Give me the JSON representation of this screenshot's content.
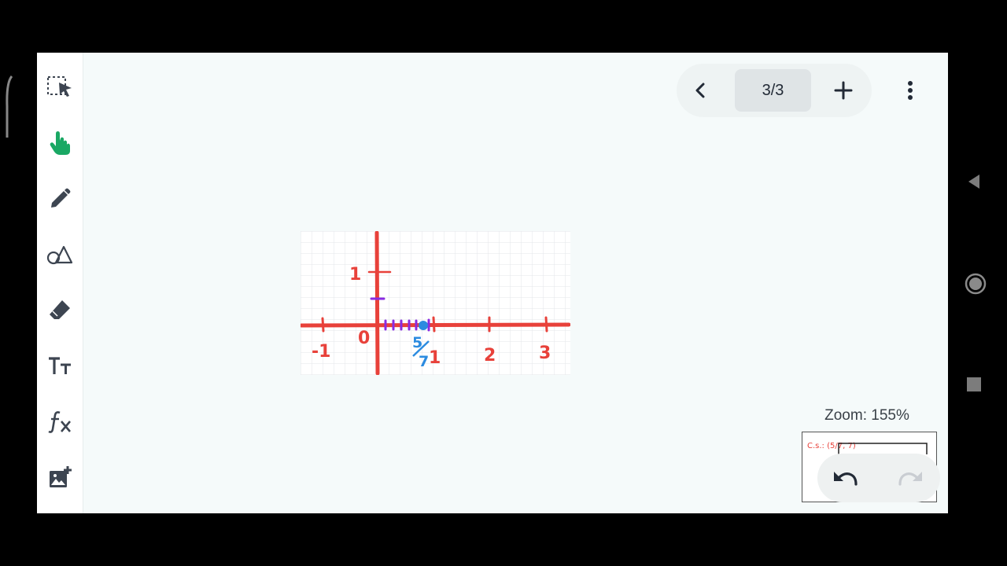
{
  "toolbar": {
    "tools": [
      "select",
      "pan",
      "pen",
      "shapes",
      "eraser",
      "text",
      "function",
      "image"
    ],
    "active_tool": "pan",
    "active_color": "#1aa864",
    "icon_color": "#3d4551"
  },
  "page_nav": {
    "indicator": "3/3",
    "icons": [
      "chevron-left-icon",
      "plus-icon"
    ]
  },
  "zoom": {
    "label": "Zoom: 155%"
  },
  "drawing": {
    "axis_color": "#e8413a",
    "mark_color": "#8a2be2",
    "point_color": "#2b8be0",
    "x_labels": [
      "-1",
      "0",
      "1",
      "2",
      "3"
    ],
    "y_labels": [
      "1"
    ],
    "fraction": {
      "numerator": "5",
      "denominator": "7"
    }
  },
  "minimap": {
    "text": "C.s.: (5/7, 7)"
  },
  "history": {
    "icons": [
      "undo-icon",
      "redo-icon"
    ]
  },
  "system_nav": {
    "icons": [
      "back-icon",
      "home-icon",
      "recents-icon"
    ]
  }
}
